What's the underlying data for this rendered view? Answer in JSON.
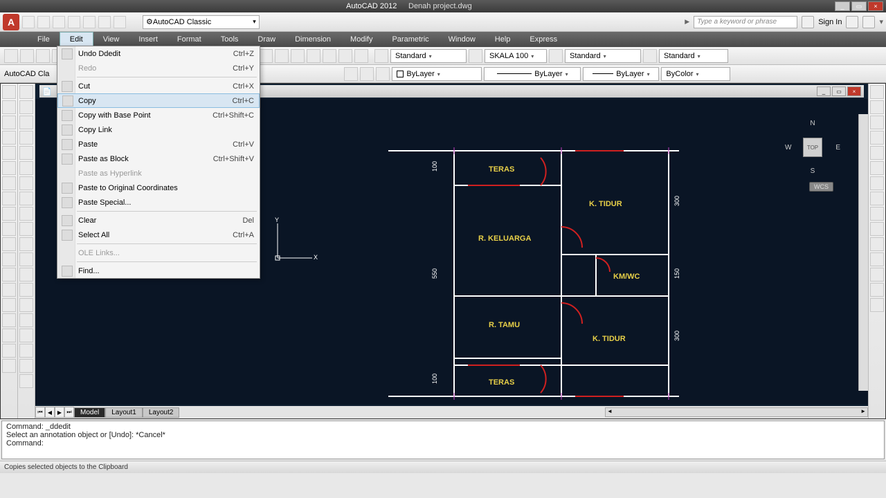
{
  "app": {
    "name": "AutoCAD 2012",
    "file": "Denah project.dwg"
  },
  "qat": {
    "workspace": "AutoCAD Classic",
    "search_placeholder": "Type a keyword or phrase",
    "signin": "Sign In"
  },
  "menus": [
    "File",
    "Edit",
    "View",
    "Insert",
    "Format",
    "Tools",
    "Draw",
    "Dimension",
    "Modify",
    "Parametric",
    "Window",
    "Help",
    "Express"
  ],
  "toolbar_row1": {
    "dd1": "Standard",
    "dd2": "SKALA 100",
    "dd3": "Standard",
    "dd4": "Standard"
  },
  "toolbar_row2": {
    "layer": "ByLayer",
    "layer2": "ByLayer",
    "layer3": "ByLayer",
    "bycolor": "ByColor",
    "ws_label": "AutoCAD Cla"
  },
  "edit_menu": [
    {
      "label": "Undo Ddedit",
      "sc": "Ctrl+Z",
      "icon": true
    },
    {
      "label": "Redo",
      "sc": "Ctrl+Y",
      "disabled": true
    },
    null,
    {
      "label": "Cut",
      "sc": "Ctrl+X",
      "icon": true
    },
    {
      "label": "Copy",
      "sc": "Ctrl+C",
      "icon": true,
      "hover": true
    },
    {
      "label": "Copy with Base Point",
      "sc": "Ctrl+Shift+C",
      "icon": true
    },
    {
      "label": "Copy Link",
      "icon": true
    },
    {
      "label": "Paste",
      "sc": "Ctrl+V",
      "icon": true
    },
    {
      "label": "Paste as Block",
      "sc": "Ctrl+Shift+V",
      "icon": true
    },
    {
      "label": "Paste as Hyperlink",
      "disabled": true
    },
    {
      "label": "Paste to Original Coordinates",
      "icon": true
    },
    {
      "label": "Paste Special...",
      "icon": true
    },
    null,
    {
      "label": "Clear",
      "sc": "Del",
      "icon": true
    },
    {
      "label": "Select All",
      "sc": "Ctrl+A",
      "icon": true
    },
    null,
    {
      "label": "OLE Links...",
      "disabled": true
    },
    null,
    {
      "label": "Find...",
      "icon": true
    }
  ],
  "rooms": {
    "teras1": "TERAS",
    "keluarga": "R. KELUARGA",
    "tidur1": "K. TIDUR",
    "kmwc": "KM/WC",
    "tamu": "R. TAMU",
    "tidur2": "K. TIDUR",
    "teras2": "TERAS"
  },
  "dims": {
    "d100a": "100",
    "d100b": "100",
    "d550": "550",
    "d300a": "300",
    "d150": "150",
    "d300b": "300"
  },
  "viewcube": {
    "top": "TOP",
    "n": "N",
    "s": "S",
    "e": "E",
    "w": "W",
    "wcs": "WCS"
  },
  "tabs": {
    "model": "Model",
    "l1": "Layout1",
    "l2": "Layout2"
  },
  "cmd": {
    "l1": "Command: _ddedit",
    "l2": "Select an annotation object or [Undo]: *Cancel*",
    "l3": "",
    "l4": "Command:"
  },
  "status": "Copies selected objects to the Clipboard",
  "window_title": "Denah project.dwg"
}
